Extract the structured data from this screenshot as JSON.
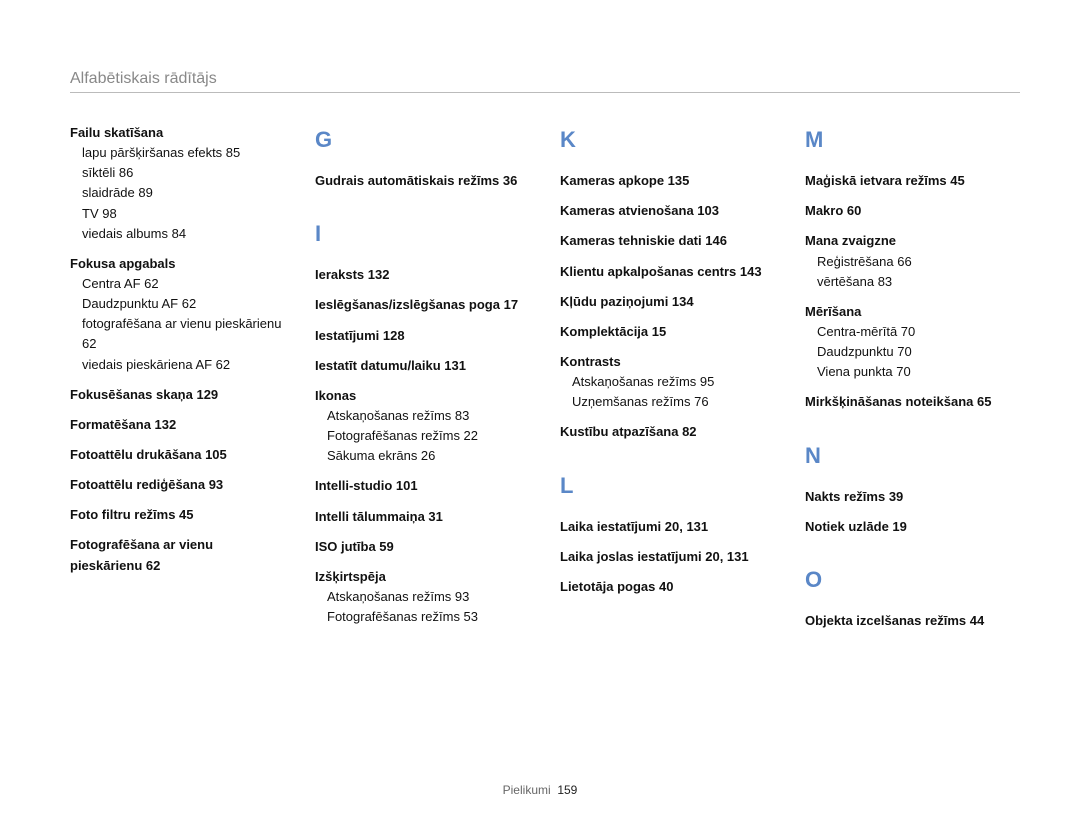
{
  "header": "Alfabētiskais rādītājs",
  "footer": {
    "label": "Pielikumi",
    "page": "159"
  },
  "col1": {
    "h1": "Failu skatīšana",
    "s1a": "lapu pāršķiršanas efekts 85",
    "s1b": "sīktēli 86",
    "s1c": "slaidrāde 89",
    "s1d": "TV 98",
    "s1e": "viedais albums 84",
    "h2": "Fokusa apgabals",
    "s2a": "Centra AF 62",
    "s2b": "Daudzpunktu AF 62",
    "s2c": "fotografēšana ar vienu pieskārienu 62",
    "s2d": "viedais pieskāriena AF 62",
    "h3": "Fokusēšanas skaņa 129",
    "h4": "Formatēšana 132",
    "h5": "Fotoattēlu drukāšana 105",
    "h6": "Fotoattēlu rediģēšana 93",
    "h7": "Foto filtru režīms 45",
    "h8": "Fotografēšana ar vienu pieskārienu 62"
  },
  "col2": {
    "L1": "G",
    "h1": "Gudrais automātiskais režīms 36",
    "L2": "I",
    "h2": "Ieraksts 132",
    "h3": "Ieslēgšanas/izslēgšanas poga 17",
    "h4": "Iestatījumi 128",
    "h5": "Iestatīt datumu/laiku 131",
    "h6": "Ikonas",
    "s6a": "Atskaņošanas režīms 83",
    "s6b": "Fotografēšanas režīms 22",
    "s6c": "Sākuma ekrāns 26",
    "h7": "Intelli-studio 101",
    "h8": "Intelli tālummaiņa 31",
    "h9": "ISO jutība 59",
    "h10": "Izšķirtspēja",
    "s10a": "Atskaņošanas režīms 93",
    "s10b": "Fotografēšanas režīms 53"
  },
  "col3": {
    "L1": "K",
    "h1": "Kameras apkope 135",
    "h2": "Kameras atvienošana 103",
    "h3": "Kameras tehniskie dati 146",
    "h4": "Klientu apkalpošanas centrs 143",
    "h5": "Kļūdu paziņojumi 134",
    "h6": "Komplektācija 15",
    "h7": "Kontrasts",
    "s7a": "Atskaņošanas režīms 95",
    "s7b": "Uzņemšanas režīms 76",
    "h8": "Kustību atpazīšana 82",
    "L2": "L",
    "h9": "Laika iestatījumi 20, 131",
    "h10": "Laika joslas iestatījumi 20, 131",
    "h11": "Lietotāja pogas 40"
  },
  "col4": {
    "L1": "M",
    "h1": "Maģiskā ietvara režīms 45",
    "h2": "Makro 60",
    "h3": "Mana zvaigzne",
    "s3a": "Reģistrēšana 66",
    "s3b": "vērtēšana 83",
    "h4": "Mērīšana",
    "s4a": "Centra-mērītā 70",
    "s4b": "Daudzpunktu 70",
    "s4c": "Viena punkta 70",
    "h5": "Mirkšķināšanas noteikšana 65",
    "L2": "N",
    "h6": "Nakts režīms 39",
    "h7": "Notiek uzlāde 19",
    "L3": "O",
    "h8": "Objekta izcelšanas režīms 44"
  }
}
